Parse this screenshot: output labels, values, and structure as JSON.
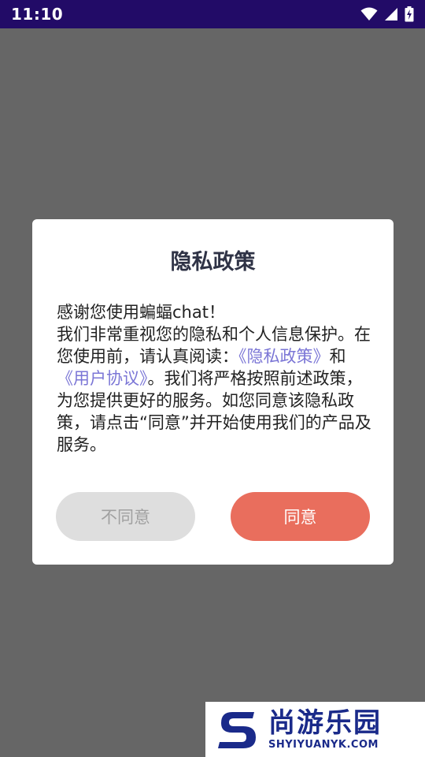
{
  "status_bar": {
    "time": "11:10",
    "icons": [
      "wifi-icon",
      "cellular-signal-icon",
      "battery-charging-icon"
    ]
  },
  "dialog": {
    "title": "隐私政策",
    "body": {
      "line1": "感谢您使用蝙蝠chat！",
      "para_prefix": "我们非常重视您的隐私和个人信息保护。在您使用前，请认真阅读：",
      "privacy_link": "《隐私政策》",
      "and": "和",
      "user_agreement_link": "《用户协议》",
      "para_suffix": "。我们将严格按照前述政策，为您提供更好的服务。如您同意该隐私政策，请点击“同意”并开始使用我们的产品及服务。"
    },
    "disagree_label": "不同意",
    "agree_label": "同意"
  },
  "watermark": {
    "cn": "尚游乐园",
    "en": "SHYIYUANYK.COM"
  },
  "colors": {
    "status_bar": "#220b67",
    "overlay": "#666666",
    "link": "#7b76d6",
    "agree_button": "#e96e5d",
    "disagree_button": "#dedede"
  }
}
